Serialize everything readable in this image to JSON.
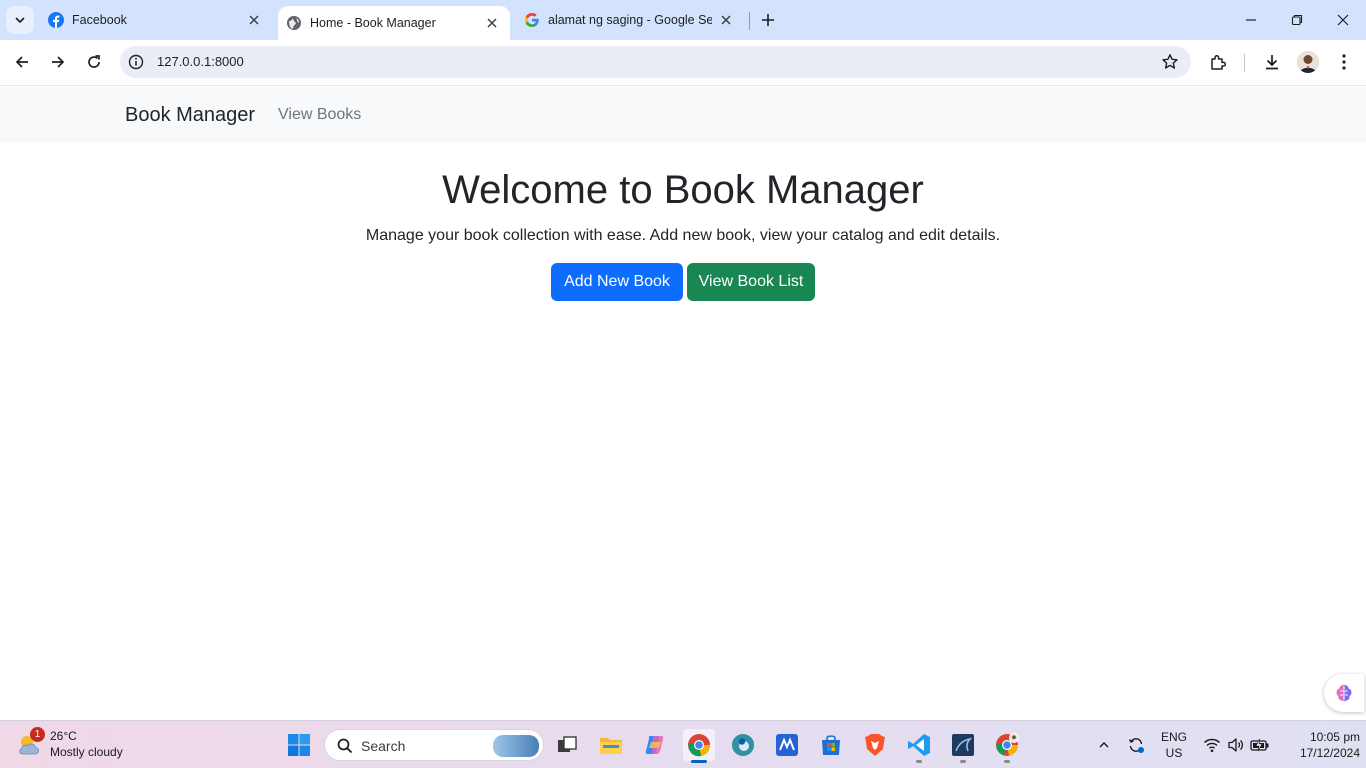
{
  "browser": {
    "tabs": [
      {
        "title": "Facebook",
        "favicon": "facebook-icon",
        "active": false
      },
      {
        "title": "Home - Book Manager",
        "favicon": "globe-icon",
        "active": true
      },
      {
        "title": "alamat ng saging - Google Search",
        "favicon": "google-icon",
        "active": false
      }
    ],
    "address": "127.0.0.1:8000"
  },
  "navbar": {
    "brand": "Book Manager",
    "links": [
      "View Books"
    ]
  },
  "hero": {
    "title": "Welcome to Book Manager",
    "subtitle": "Manage your book collection with ease. Add new book, view your catalog and edit details.",
    "primary_button": "Add New Book",
    "secondary_button": "View Book List"
  },
  "colors": {
    "primary": "#0d6efd",
    "success": "#198754",
    "navbar_bg": "#f8f9fa",
    "tabstrip_bg": "#d3e3fd"
  },
  "taskbar": {
    "weather": {
      "badge": "1",
      "temp": "26°C",
      "condition": "Mostly cloudy"
    },
    "search_placeholder": "Search",
    "language": {
      "line1": "ENG",
      "line2": "US"
    },
    "clock": {
      "time": "10:05 pm",
      "date": "17/12/2024"
    },
    "apps": [
      "windows-start-icon",
      "search",
      "task-view-icon",
      "file-explorer-icon",
      "copilot-icon",
      "chrome-icon",
      "edge-icon",
      "mathway-icon",
      "microsoft-store-icon",
      "brave-icon",
      "vscode-icon",
      "mysql-workbench-icon",
      "chrome-profile-icon"
    ]
  }
}
